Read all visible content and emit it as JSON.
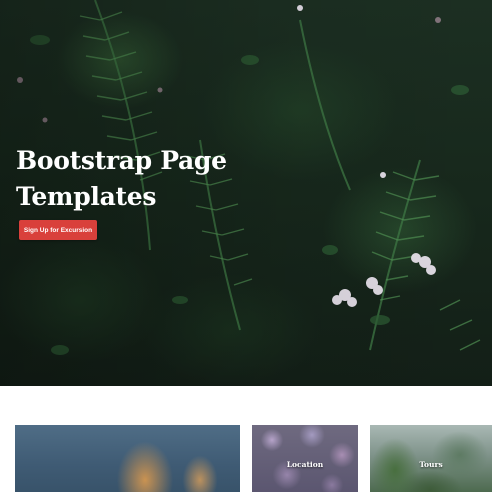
{
  "hero": {
    "title_line1": "Bootstrap Page",
    "title_line2": "Templates",
    "cta_label": "Sign Up for Excursion",
    "cta_color": "#d9403b"
  },
  "cards": [
    {
      "label": ""
    },
    {
      "label": "Location"
    },
    {
      "label": "Tours"
    }
  ]
}
